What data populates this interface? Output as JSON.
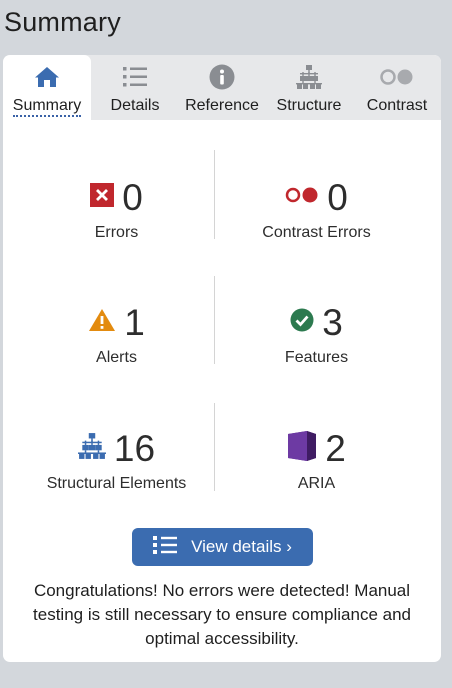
{
  "page": {
    "title": "Summary"
  },
  "tabs": [
    {
      "label": "Summary",
      "icon": "home-icon",
      "active": true
    },
    {
      "label": "Details",
      "icon": "list-icon",
      "active": false
    },
    {
      "label": "Reference",
      "icon": "info-icon",
      "active": false
    },
    {
      "label": "Structure",
      "icon": "structure-icon",
      "active": false
    },
    {
      "label": "Contrast",
      "icon": "contrast-icon",
      "active": false
    }
  ],
  "summary": {
    "errors": {
      "count": "0",
      "label": "Errors",
      "icon": "error-icon",
      "color": "#c0272d"
    },
    "contrast_errors": {
      "count": "0",
      "label": "Contrast Errors",
      "icon": "contrast-error-icon",
      "color": "#c0272d"
    },
    "alerts": {
      "count": "1",
      "label": "Alerts",
      "icon": "alert-icon",
      "color": "#e38b0f"
    },
    "features": {
      "count": "3",
      "label": "Features",
      "icon": "feature-check-icon",
      "color": "#2c7a4f"
    },
    "structural": {
      "count": "16",
      "label": "Structural Elements",
      "icon": "structure-icon",
      "color": "#3b6cb0"
    },
    "aria": {
      "count": "2",
      "label": "ARIA",
      "icon": "aria-icon",
      "color": "#5b2c8a"
    }
  },
  "button": {
    "label": "View details ›",
    "icon": "list-icon"
  },
  "message": "Congratulations! No errors were detected! Manual testing is still necessary to ensure compliance and optimal accessibility.",
  "colors": {
    "accent": "#3b6cb0",
    "background": "#d3d7dc",
    "tab_bar": "#e7e8ea"
  }
}
